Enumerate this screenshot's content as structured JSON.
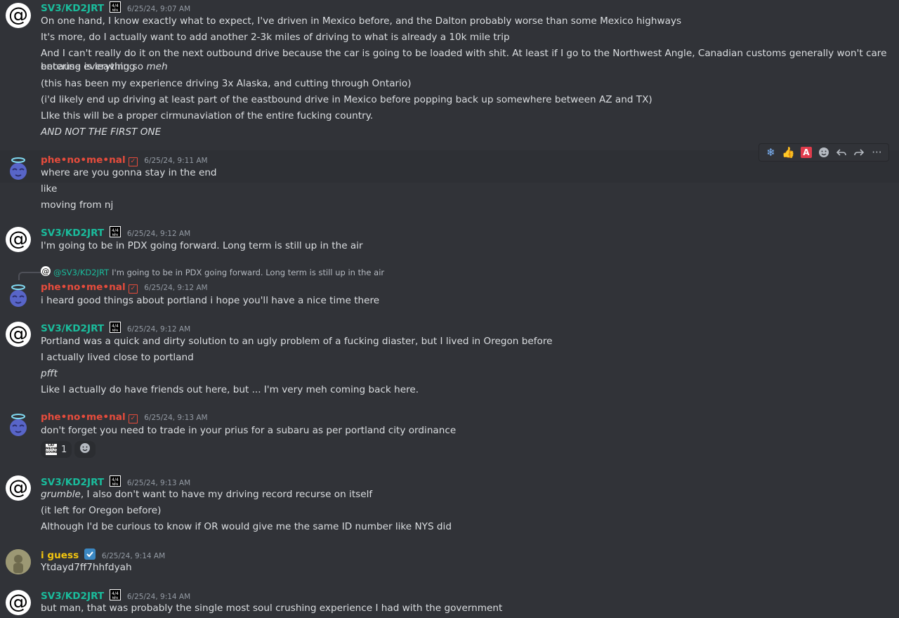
{
  "colors": {
    "teal_name": "#1abc9c",
    "red_name": "#e74c3c",
    "gold_name": "#f1c40f",
    "background": "#313338",
    "timestamp": "#949ba4"
  },
  "messages": [
    {
      "author": "SV3/KD2JRT",
      "badge": "4/4 MPH",
      "timestamp": "6/25/24, 9:07 AM",
      "lines": [
        "On one hand, I know exactly what to expect, I've driven in Mexico before, and the Dalton probably worse than some Mexico highways",
        "It's more, do I actually want to add another 2-3k miles of driving to what is already a 10k mile trip",
        "And I can't really do it on the next outbound drive because the car is going to be loaded with shit. At least if I go to the Northwest Angle, Canadian customs generally won't care because everything",
        "entering is leaving so ",
        "meh",
        "(this has been my experience driving 3x Alaska, and cutting through Ontario)",
        "(i'd likely end up driving at least part of the eastbound drive in Mexico before popping back up somewhere between AZ and TX)",
        "LIke this will be a proper cirmunaviation of the entire fucking country.",
        "AND NOT THE FIRST ONE"
      ]
    },
    {
      "author": "phe•no•me•nal",
      "timestamp": "6/25/24, 9:11 AM",
      "lines": [
        "where are you gonna stay in the end",
        "like",
        "moving from nj"
      ]
    },
    {
      "author": "SV3/KD2JRT",
      "timestamp": "6/25/24, 9:12 AM",
      "lines": [
        "I'm going to be in PDX going forward. Long term is still up in the air"
      ]
    },
    {
      "author": "phe•no•me•nal",
      "timestamp": "6/25/24, 9:12 AM",
      "reply": {
        "name": "@SV3/KD2JRT",
        "text": "I'm going to be in PDX going forward. Long term is still up in the air"
      },
      "lines": [
        "i heard good things about portland i hope you'll have a nice time there"
      ]
    },
    {
      "author": "SV3/KD2JRT",
      "timestamp": "6/25/24, 9:12 AM",
      "lines": [
        "Portland was a quick and dirty solution to an ugly problem of a fucking diaster, but I lived in Oregon before",
        "I actually lived close to portland",
        "pfft",
        "Like I actually do have friends out here, but ... I'm very meh coming back here."
      ]
    },
    {
      "author": "phe•no•me•nal",
      "timestamp": "6/25/24, 9:13 AM",
      "lines": [
        "don't forget you need to trade in your prius for a subaru as per portland city ordinance"
      ],
      "reaction": {
        "emoji_text": "CAT MEOW SOUND",
        "count": "1"
      }
    },
    {
      "author": "SV3/KD2JRT",
      "timestamp": "6/25/24, 9:13 AM",
      "lines": [
        "grumble",
        ", I also don't want to have my driving record recurse on itself",
        "(it left for Oregon before)",
        "Although I'd be curious to know if OR would give me the same ID number like NYS did"
      ]
    },
    {
      "author": "i guess",
      "timestamp": "6/25/24, 9:14 AM",
      "lines": [
        "Ytdayd7ff7hhfdyah"
      ]
    },
    {
      "author": "SV3/KD2JRT",
      "timestamp": "6/25/24, 9:14 AM",
      "lines": [
        "but man, that was probably the single most soul crushing experience I had with the government"
      ]
    }
  ],
  "toolbar": {
    "icons": [
      "snowflake-icon",
      "thumbs-up-icon",
      "letter-a-icon",
      "add-reaction-icon",
      "reply-icon",
      "forward-icon",
      "more-icon"
    ],
    "snowflake": "❄",
    "thumbsup": "👍",
    "letter_a": "A",
    "more": "···"
  }
}
